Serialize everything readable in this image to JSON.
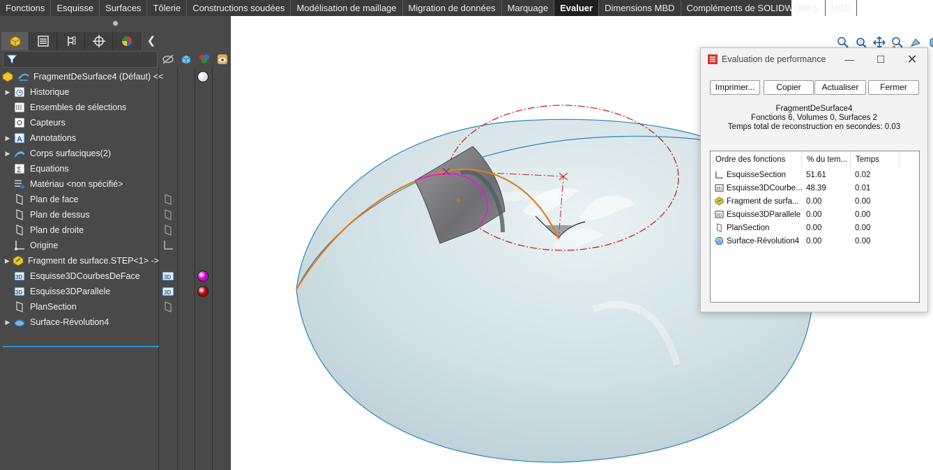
{
  "tabs": [
    "Fonctions",
    "Esquisse",
    "Surfaces",
    "Tôlerie",
    "Constructions soudées",
    "Modélisation de maillage",
    "Migration de données",
    "Marquage",
    "Evaluer",
    "Dimensions MBD",
    "Compléments de SOLIDWORKS",
    "MBD"
  ],
  "active_tab": "Evaluer",
  "feature_tree": {
    "root": "FragmentDeSurface4  (Défaut) <<",
    "items": [
      {
        "label": "Historique",
        "icon": "history-icon",
        "expandable": true
      },
      {
        "label": "Ensembles de sélections",
        "icon": "selection-sets-icon",
        "expandable": false
      },
      {
        "label": "Capteurs",
        "icon": "sensors-icon",
        "expandable": false
      },
      {
        "label": "Annotations",
        "icon": "annotations-icon",
        "expandable": true
      },
      {
        "label": "Corps surfaciques(2)",
        "icon": "surface-bodies-icon",
        "expandable": true
      },
      {
        "label": "Equations",
        "icon": "equations-icon",
        "expandable": false
      },
      {
        "label": "Matériau <non spécifié>",
        "icon": "material-icon",
        "expandable": false
      },
      {
        "label": "Plan de face",
        "icon": "plane-icon",
        "expandable": false
      },
      {
        "label": "Plan de dessus",
        "icon": "plane-icon",
        "expandable": false
      },
      {
        "label": "Plan de droite",
        "icon": "plane-icon",
        "expandable": false
      },
      {
        "label": "Origine",
        "icon": "origin-icon",
        "expandable": false
      },
      {
        "label": "Fragment de surface.STEP<1> ->",
        "icon": "part-icon",
        "expandable": true
      },
      {
        "label": "Esquisse3DCourbesDeFace",
        "icon": "sketch-3d-icon",
        "expandable": false
      },
      {
        "label": "Esquisse3DParallele",
        "icon": "sketch-3d-icon",
        "expandable": false
      },
      {
        "label": "PlanSection",
        "icon": "plane-icon",
        "expandable": false
      },
      {
        "label": "Surface-Révolution4",
        "icon": "revolve-surface-icon",
        "expandable": true
      }
    ]
  },
  "dialog": {
    "title": "Evaluation de performance",
    "buttons": {
      "print": "Imprimer...",
      "copy": "Copier",
      "refresh": "Actualiser",
      "close": "Fermer"
    },
    "part_name": "FragmentDeSurface4",
    "summary": "Fonctions 6, Volumes 0, Surfaces 2",
    "rebuild_time": "Temps total de reconstruction en secondes: 0.03",
    "columns": [
      "Ordre des fonctions",
      "% du tem...",
      "Temps"
    ],
    "rows": [
      {
        "name": "EsquisseSection",
        "percent": "51.61",
        "time": "0.02",
        "icon": "sketch-icon"
      },
      {
        "name": "Esquisse3DCourbe...",
        "percent": "48.39",
        "time": "0.01",
        "icon": "sketch-3d-icon"
      },
      {
        "name": "Fragment de surfa...",
        "percent": "0.00",
        "time": "0.00",
        "icon": "part-icon"
      },
      {
        "name": "Esquisse3DParallele",
        "percent": "0.00",
        "time": "0.00",
        "icon": "sketch-3d-icon"
      },
      {
        "name": "PlanSection",
        "percent": "0.00",
        "time": "0.00",
        "icon": "plane-icon"
      },
      {
        "name": "Surface-Révolution4",
        "percent": "0.00",
        "time": "0.00",
        "icon": "revolve-surface-icon"
      }
    ]
  },
  "colors": {
    "dome_fill": "#cfdfe4",
    "dome_edge": "#2a86b8",
    "orange_curve": "#e57c18",
    "magenta_curve": "#e020d0",
    "red_dashdot": "#cc2020",
    "patch": "#7c7c80",
    "appearance_magenta": "#d000d0",
    "appearance_red": "#b00000"
  }
}
